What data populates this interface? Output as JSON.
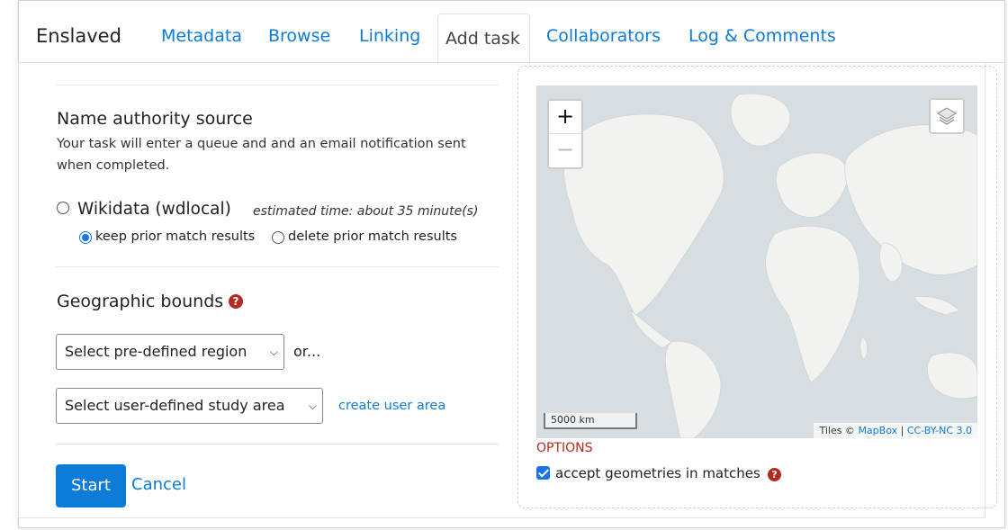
{
  "tabs": {
    "title": "Enslaved",
    "items": [
      "Metadata",
      "Browse",
      "Linking",
      "Add task",
      "Collaborators",
      "Log & Comments"
    ],
    "active": "Add task"
  },
  "name_authority": {
    "heading": "Name authority source",
    "description_line1": "Your task will enter a queue and and an email notification sent",
    "description_line2": "when completed.",
    "source_label": "Wikidata (wdlocal)",
    "estimate": "estimated time: about 35 minute(s)",
    "keep_label": "keep prior match results",
    "delete_label": "delete prior match results"
  },
  "geographic": {
    "heading": "Geographic bounds",
    "predefined_select": "Select pre-defined region",
    "or_text": "or...",
    "user_select": "Select user-defined study area",
    "create_link": "create user area"
  },
  "actions": {
    "start": "Start",
    "cancel": "Cancel"
  },
  "map": {
    "zoom_in": "+",
    "zoom_out": "−",
    "scale": "5000 km",
    "attribution_prefix": "Tiles ©",
    "attribution_mapbox": "MapBox",
    "attribution_sep": "|",
    "attribution_license": "CC-BY-NC 3.0"
  },
  "options": {
    "heading": "OPTIONS",
    "accept_geometries": "accept geometries in matches"
  },
  "colors": {
    "link": "#0d7bd8",
    "accent_red": "#b42a1c",
    "primary_button": "#0d7bd8",
    "map_water": "#d7dde0",
    "map_land": "#f2f2f0"
  }
}
